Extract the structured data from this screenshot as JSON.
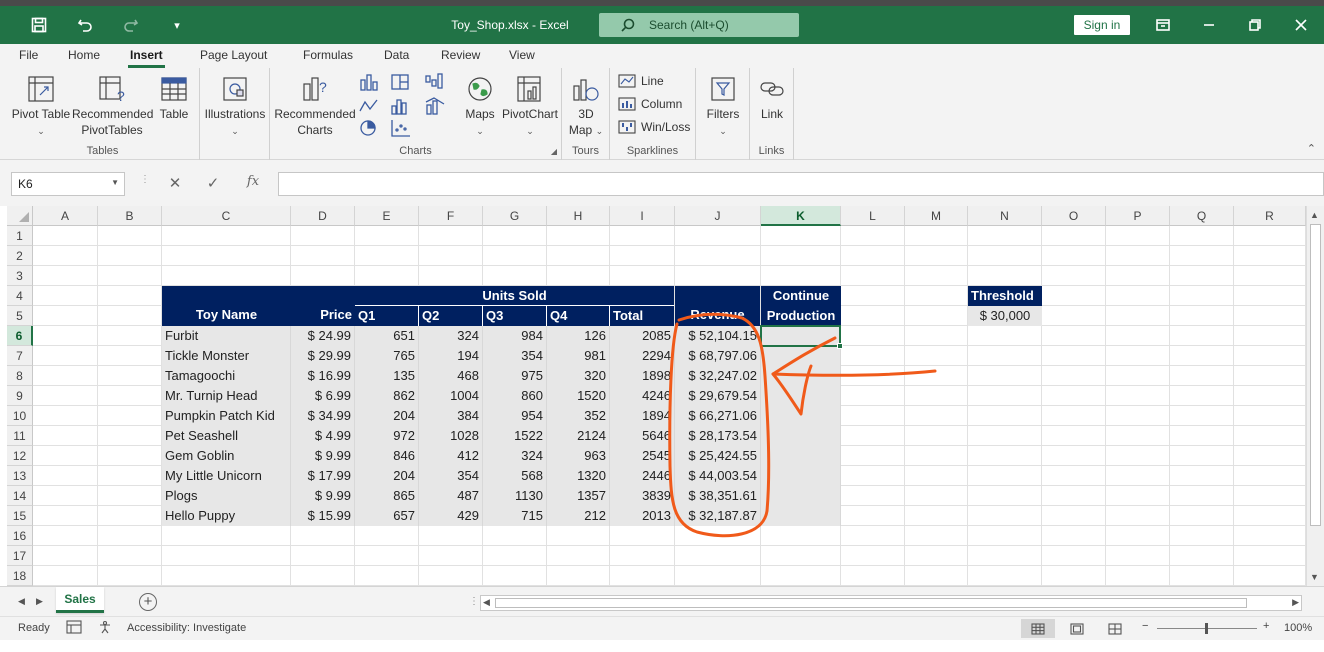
{
  "titlebar": {
    "filename": "Toy_Shop.xlsx - Excel",
    "search_placeholder": "Search (Alt+Q)",
    "signin_label": "Sign in"
  },
  "ribbon_tabs": [
    "File",
    "Home",
    "Insert",
    "Page Layout",
    "Formulas",
    "Data",
    "Review",
    "View"
  ],
  "ribbon": {
    "tables": {
      "label": "Tables",
      "pivot_table": "Pivot Table",
      "recommended_pivot_1": "Recommended",
      "recommended_pivot_2": "PivotTables",
      "table": "Table"
    },
    "illustrations": {
      "label": "Illustrations"
    },
    "charts": {
      "label": "Charts",
      "recommended_1": "Recommended",
      "recommended_2": "Charts",
      "maps": "Maps",
      "pivotchart": "PivotChart"
    },
    "tours": {
      "label": "Tours",
      "map3d_1": "3D",
      "map3d_2": "Map"
    },
    "sparklines": {
      "label": "Sparklines",
      "line": "Line",
      "column": "Column",
      "winloss": "Win/Loss"
    },
    "filters": {
      "label": "Filters"
    },
    "links": {
      "label": "Links",
      "link": "Link"
    }
  },
  "formula_bar": {
    "name_box": "K6",
    "fx": "fx",
    "value": ""
  },
  "columns": [
    "A",
    "B",
    "C",
    "D",
    "E",
    "F",
    "G",
    "H",
    "I",
    "J",
    "K",
    "L",
    "M",
    "N",
    "O",
    "P",
    "Q",
    "R"
  ],
  "rows": [
    "1",
    "2",
    "3",
    "4",
    "5",
    "6",
    "7",
    "8",
    "9",
    "10",
    "11",
    "12",
    "13",
    "14",
    "15",
    "16",
    "17",
    "18"
  ],
  "selected_cell": {
    "column": "K",
    "row": "6"
  },
  "table": {
    "h_toy_name": "Toy Name",
    "h_price": "Price",
    "h_units_sold": "Units Sold",
    "h_q1": "Q1",
    "h_q2": "Q2",
    "h_q3": "Q3",
    "h_q4": "Q4",
    "h_total": "Total",
    "h_revenue": "Revenue",
    "h_continue_1": "Continue",
    "h_continue_2": "Production",
    "rows": [
      {
        "name": "Furbit",
        "price": "$ 24.99",
        "q1": "651",
        "q2": "324",
        "q3": "984",
        "q4": "126",
        "total": "2085",
        "revenue": "$ 52,104.15"
      },
      {
        "name": "Tickle Monster",
        "price": "$ 29.99",
        "q1": "765",
        "q2": "194",
        "q3": "354",
        "q4": "981",
        "total": "2294",
        "revenue": "$ 68,797.06"
      },
      {
        "name": "Tamagoochi",
        "price": "$ 16.99",
        "q1": "135",
        "q2": "468",
        "q3": "975",
        "q4": "320",
        "total": "1898",
        "revenue": "$ 32,247.02"
      },
      {
        "name": "Mr. Turnip Head",
        "price": "$ 6.99",
        "q1": "862",
        "q2": "1004",
        "q3": "860",
        "q4": "1520",
        "total": "4246",
        "revenue": "$ 29,679.54"
      },
      {
        "name": "Pumpkin Patch Kid",
        "price": "$ 34.99",
        "q1": "204",
        "q2": "384",
        "q3": "954",
        "q4": "352",
        "total": "1894",
        "revenue": "$ 66,271.06"
      },
      {
        "name": "Pet Seashell",
        "price": "$ 4.99",
        "q1": "972",
        "q2": "1028",
        "q3": "1522",
        "q4": "2124",
        "total": "5646",
        "revenue": "$ 28,173.54"
      },
      {
        "name": "Gem Goblin",
        "price": "$ 9.99",
        "q1": "846",
        "q2": "412",
        "q3": "324",
        "q4": "963",
        "total": "2545",
        "revenue": "$ 25,424.55"
      },
      {
        "name": "My Little Unicorn",
        "price": "$ 17.99",
        "q1": "204",
        "q2": "354",
        "q3": "568",
        "q4": "1320",
        "total": "2446",
        "revenue": "$ 44,003.54"
      },
      {
        "name": "Plogs",
        "price": "$ 9.99",
        "q1": "865",
        "q2": "487",
        "q3": "1130",
        "q4": "1357",
        "total": "3839",
        "revenue": "$ 38,351.61"
      },
      {
        "name": "Hello Puppy",
        "price": "$ 15.99",
        "q1": "657",
        "q2": "429",
        "q3": "715",
        "q4": "212",
        "total": "2013",
        "revenue": "$ 32,187.87"
      }
    ]
  },
  "threshold": {
    "label": "Threshold",
    "value": "$ 30,000"
  },
  "sheet_tabs": {
    "active": "Sales"
  },
  "status": {
    "ready": "Ready",
    "accessibility": "Accessibility: Investigate",
    "zoom": "100%"
  },
  "colors": {
    "excel_green": "#217346",
    "header_navy": "#002060",
    "annotation_orange": "#f05a1a",
    "shade": "#e7e7e7"
  }
}
